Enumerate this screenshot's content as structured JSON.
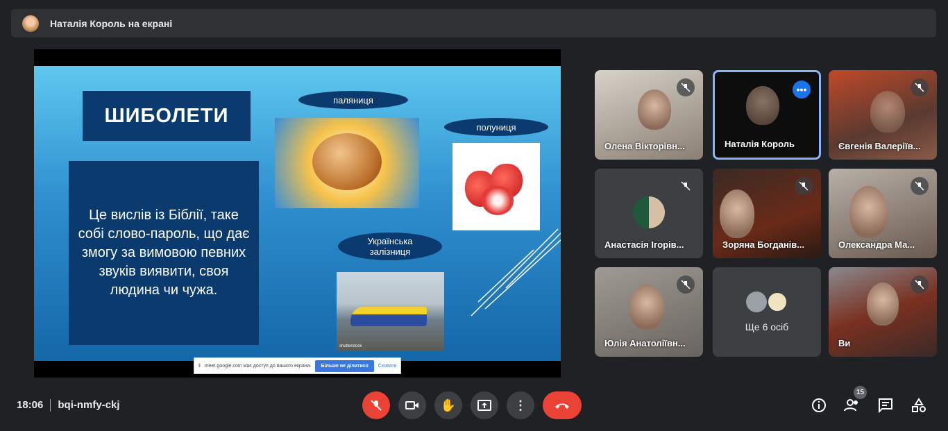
{
  "header": {
    "presenter_label": "Наталія Король на екрані"
  },
  "slide": {
    "title": "ШИБОЛЕТИ",
    "body": "Це вислів із Біблії, таке собі слово-пароль, що дає змогу за вимовою певних звуків виявити, своя людина чи чужа.",
    "labels": [
      "паляниця",
      "полуниця",
      "Українська залізниця"
    ],
    "watermark": "shutterstock"
  },
  "share_bar": {
    "text": "meet.google.com має доступ до вашого екрана.",
    "stop_label": "Більше не ділитися",
    "hide_label": "Сховати"
  },
  "participants": [
    {
      "name": "Олена Вікторівн...",
      "muted": true
    },
    {
      "name": "Наталія Король",
      "muted": false,
      "active": true
    },
    {
      "name": "Євгенія Валеріїв...",
      "muted": true
    },
    {
      "name": "Анастасія Ігорів...",
      "muted": true
    },
    {
      "name": "Зоряна Богданів...",
      "muted": true
    },
    {
      "name": "Олександра Ма...",
      "muted": true
    },
    {
      "name": "Юлія Анатоліївн...",
      "muted": true
    },
    {
      "name": "Ще 6 осіб"
    },
    {
      "name": "Ви",
      "muted": true
    }
  ],
  "footer": {
    "time": "18:06",
    "meeting_code": "bqi-nmfy-ckj",
    "people_count": "15"
  },
  "colors": {
    "accent": "#1a73e8",
    "danger": "#ea4335",
    "bg": "#202124"
  }
}
